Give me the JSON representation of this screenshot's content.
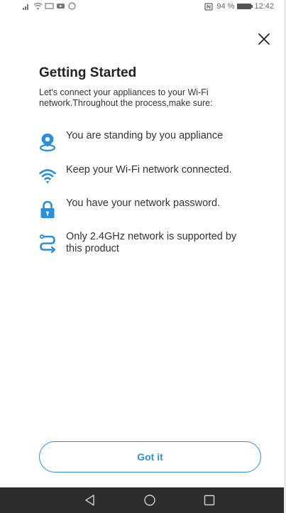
{
  "status_bar": {
    "battery": "94 %",
    "time": "12:42"
  },
  "dialog": {
    "title": "Getting Started",
    "intro": "Let's connect your appliances to your Wi-Fi network.Throughout the process,make sure:",
    "requirements": [
      {
        "icon": "location-pin-icon",
        "text": "You are standing by you appliance"
      },
      {
        "icon": "wifi-icon",
        "text": "Keep your Wi-Fi network connected."
      },
      {
        "icon": "lock-icon",
        "text": "You have your network password."
      },
      {
        "icon": "route-icon",
        "text": "Only 2.4GHz network is supported by this product"
      }
    ],
    "button_label": "Got it"
  },
  "colors": {
    "accent": "#2b8fe0",
    "navbar": "#2d2d2d"
  }
}
